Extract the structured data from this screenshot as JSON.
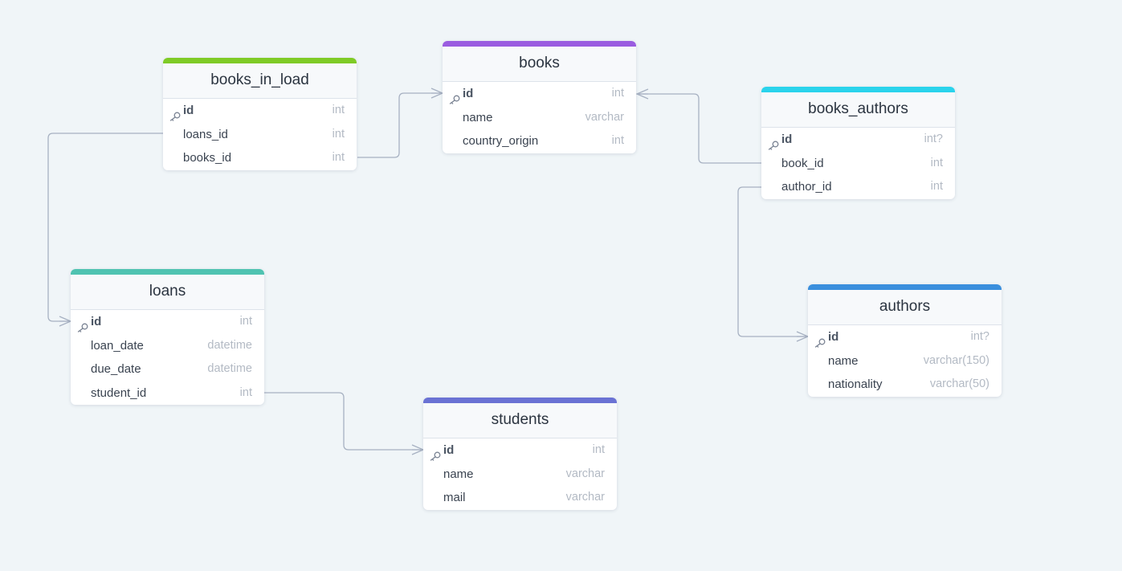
{
  "tables": {
    "books_in_load": {
      "name": "books_in_load",
      "color": "#7fcb26",
      "fields": [
        {
          "name": "id",
          "type": "int",
          "pk": true
        },
        {
          "name": "loans_id",
          "type": "int",
          "pk": false
        },
        {
          "name": "books_id",
          "type": "int",
          "pk": false
        }
      ]
    },
    "books": {
      "name": "books",
      "color": "#9a5ce0",
      "fields": [
        {
          "name": "id",
          "type": "int",
          "pk": true
        },
        {
          "name": "name",
          "type": "varchar",
          "pk": false
        },
        {
          "name": "country_origin",
          "type": "int",
          "pk": false
        }
      ]
    },
    "books_authors": {
      "name": "books_authors",
      "color": "#2ad3ec",
      "fields": [
        {
          "name": "id",
          "type": "int?",
          "pk": true
        },
        {
          "name": "book_id",
          "type": "int",
          "pk": false
        },
        {
          "name": "author_id",
          "type": "int",
          "pk": false
        }
      ]
    },
    "loans": {
      "name": "loans",
      "color": "#4fc3b1",
      "fields": [
        {
          "name": "id",
          "type": "int",
          "pk": true
        },
        {
          "name": "loan_date",
          "type": "datetime",
          "pk": false
        },
        {
          "name": "due_date",
          "type": "datetime",
          "pk": false
        },
        {
          "name": "student_id",
          "type": "int",
          "pk": false
        }
      ]
    },
    "authors": {
      "name": "authors",
      "color": "#3a8fdd",
      "fields": [
        {
          "name": "id",
          "type": "int?",
          "pk": true
        },
        {
          "name": "name",
          "type": "varchar(150)",
          "pk": false
        },
        {
          "name": "nationality",
          "type": "varchar(50)",
          "pk": false
        }
      ]
    },
    "students": {
      "name": "students",
      "color": "#6a72d4",
      "fields": [
        {
          "name": "id",
          "type": "int",
          "pk": true
        },
        {
          "name": "name",
          "type": "varchar",
          "pk": false
        },
        {
          "name": "mail",
          "type": "varchar",
          "pk": false
        }
      ]
    }
  },
  "relations": [
    {
      "from": "books_in_load.loans_id",
      "to": "loans.id",
      "to_end": "many"
    },
    {
      "from": "books_in_load.books_id",
      "to": "books.id",
      "to_end": "many"
    },
    {
      "from": "books.id",
      "to": "books_authors.book_id",
      "from_end": "many"
    },
    {
      "from": "books_authors.author_id",
      "to": "authors.id",
      "to_end": "many"
    },
    {
      "from": "loans.student_id",
      "to": "students.id",
      "to_end": "many"
    }
  ],
  "icons": {
    "primary_key": "key-icon",
    "many_end": "crows-foot-icon"
  }
}
